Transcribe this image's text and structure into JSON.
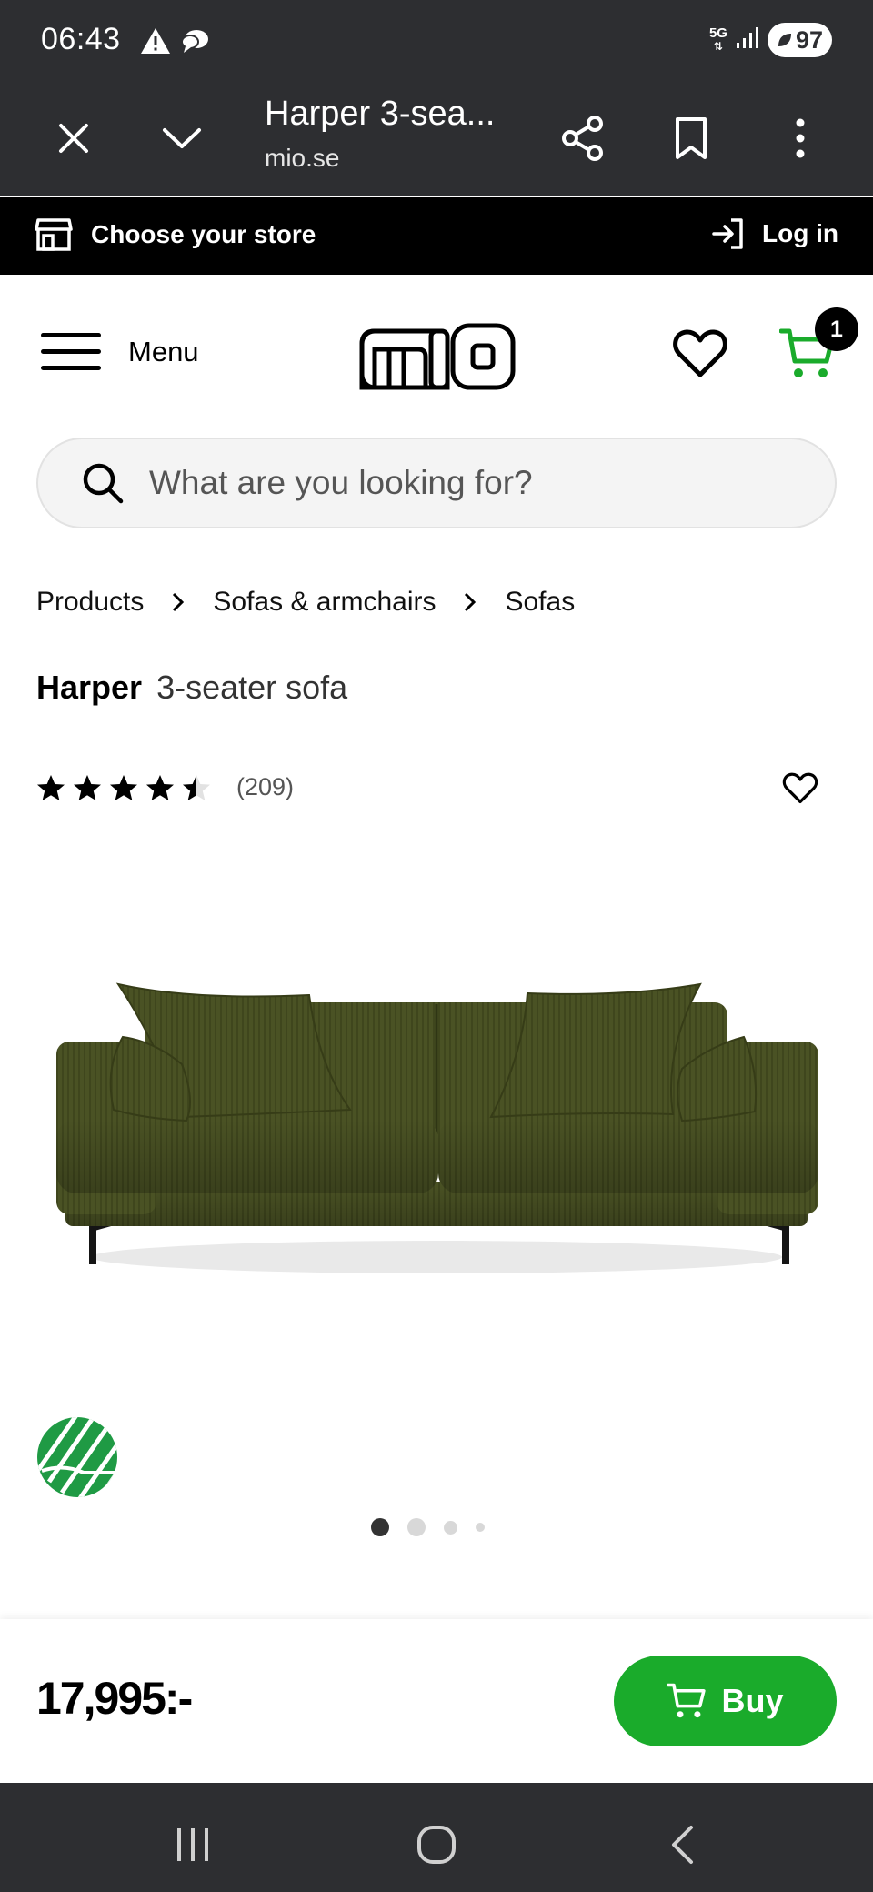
{
  "status_bar": {
    "time": "06:43",
    "network": "5G",
    "battery": "97"
  },
  "browser": {
    "page_title": "Harper 3-sea...",
    "domain": "mio.se",
    "icons": [
      "close-icon",
      "chevron-down-icon",
      "share-icon",
      "bookmark-icon",
      "more-vert-icon"
    ]
  },
  "store_bar": {
    "choose_store": "Choose your store",
    "login": "Log in"
  },
  "header": {
    "menu_label": "Menu",
    "logo_text": "mio",
    "cart_count": "1",
    "accent_color": "#1aab2b"
  },
  "search": {
    "placeholder": "What are you looking for?",
    "value": ""
  },
  "breadcrumb": [
    "Products",
    "Sofas & armchairs",
    "Sofas"
  ],
  "product": {
    "name": "Harper",
    "subtitle": "3-seater sofa",
    "rating": 4.5,
    "rating_max": 5,
    "review_count": "(209)",
    "image_color": "#4a5224",
    "gallery_active_index": 0,
    "gallery_count": 4
  },
  "buy_bar": {
    "price": "17,995:-",
    "buy_label": "Buy"
  }
}
